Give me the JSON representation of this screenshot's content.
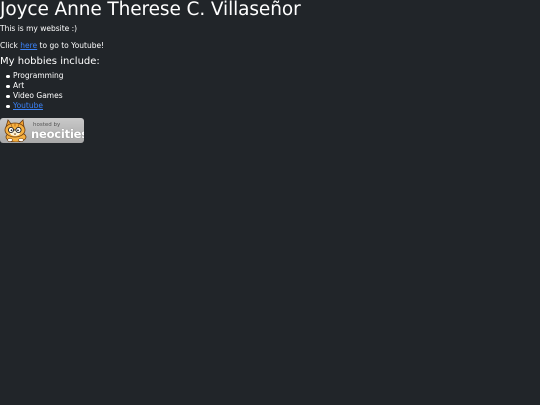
{
  "header": {
    "title": "Joyce Anne Therese C. Villaseñor"
  },
  "intro": {
    "text": "This is my website :)"
  },
  "youtube_line": {
    "prefix": "Click ",
    "link_label": "here",
    "suffix": " to go to Youtube!"
  },
  "hobbies": {
    "heading": "My hobbies include:",
    "items": [
      {
        "label": "Programming",
        "is_link": false
      },
      {
        "label": "Art",
        "is_link": false
      },
      {
        "label": "Video Games",
        "is_link": false
      },
      {
        "label": "Youtube",
        "is_link": true
      }
    ]
  },
  "badge": {
    "small_text": "hosted by",
    "brand_text": "neocities",
    "icon": "neocities-cat-icon"
  },
  "colors": {
    "background": "#212529",
    "text": "#ffffff",
    "link": "#3b82f6"
  }
}
